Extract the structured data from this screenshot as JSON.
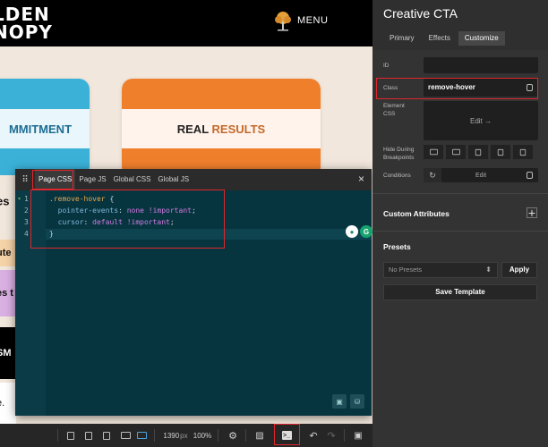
{
  "site": {
    "logo_line1": "LDEN",
    "logo_line2": "NOPY",
    "menu": "MENU",
    "card_left": "MMITMENT",
    "card_right_a": "REAL ",
    "card_right_b": "RESULTS",
    "strip_a": "es",
    "strip_b": "ute",
    "strip_c": "es t",
    "strip_d": "SM",
    "strip_e": "e."
  },
  "editor": {
    "tabs": [
      "Page CSS",
      "Page JS",
      "Global CSS",
      "Global JS"
    ],
    "active_tab": "Page CSS",
    "close": "×",
    "line_numbers": [
      "1",
      "2",
      "3",
      "4"
    ],
    "code": {
      "l1_sel": ".remove-hover",
      "l1_rest": " {",
      "l2_prop": "  pointer-events",
      "l2_colon": ": ",
      "l2_val": "none",
      "l2_imp": " !important",
      "l2_end": ";",
      "l3_prop": "  cursor",
      "l3_colon": ": ",
      "l3_val": "default",
      "l3_imp": " !important",
      "l3_end": ";",
      "l4": "}"
    }
  },
  "toolbar": {
    "width_value": "1390",
    "width_unit": "px",
    "zoom": "100%"
  },
  "panel": {
    "title": "Creative CTA",
    "tabs": [
      "Primary",
      "Effects",
      "Customize"
    ],
    "active_tab": "Customize",
    "id_label": "ID",
    "id_value": "",
    "class_label": "Class",
    "class_value": "remove-hover",
    "element_css_label": "Element CSS",
    "element_css_button": "Edit →",
    "hide_label": "Hide During Breakpoints",
    "conditions_label": "Conditions",
    "conditions_edit": "Edit",
    "custom_attributes": "Custom Attributes",
    "presets_title": "Presets",
    "presets_select": "No Presets",
    "apply": "Apply",
    "save_template": "Save Template"
  },
  "colors": {
    "highlight": "#e0262b",
    "accent_orange": "#f07f2c",
    "accent_blue": "#3bb1d8",
    "editor_bg": "#063540"
  },
  "icons": {
    "menu_logo": "tree-icon",
    "drag": "drag-handle-icon",
    "close": "close-icon",
    "terminal": "terminal-icon",
    "undo": "undo-icon",
    "redo": "redo-icon",
    "settings": "gear-icon",
    "database": "database-icon"
  }
}
